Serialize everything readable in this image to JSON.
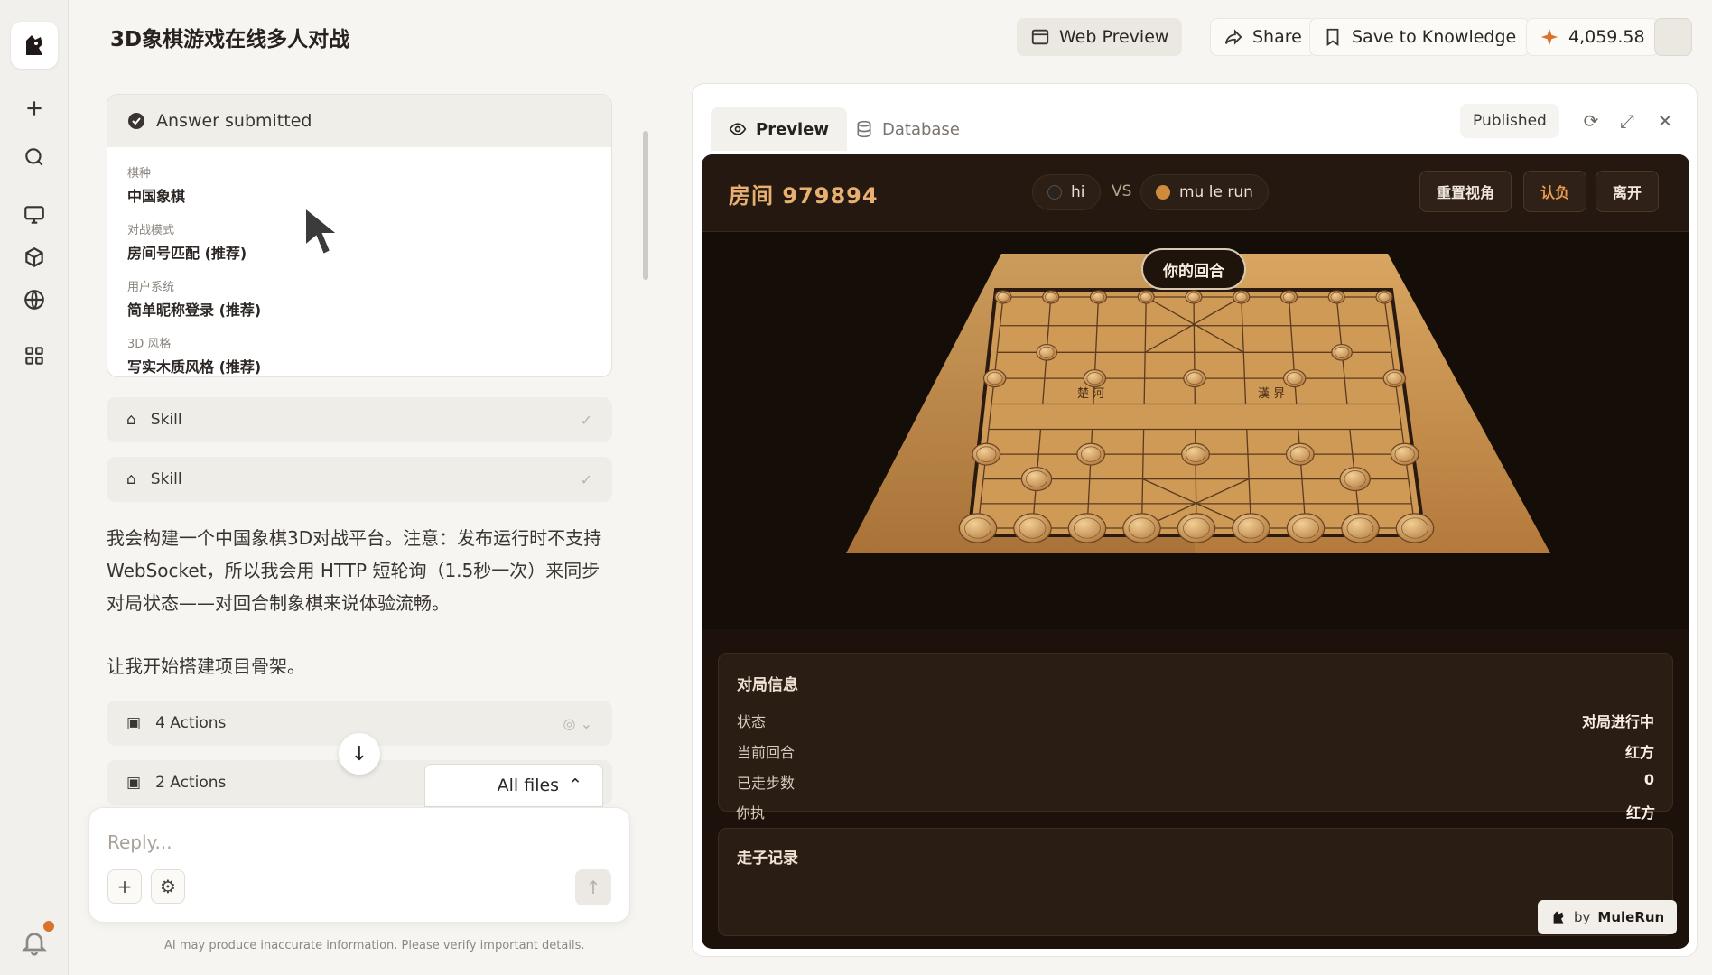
{
  "header": {
    "title": "3D象棋游戏在线多人对战",
    "web_preview": "Web Preview",
    "share": "Share",
    "save_to_knowledge": "Save to Knowledge",
    "credits": "4,059.58"
  },
  "chat": {
    "answer_card": {
      "title": "Answer submitted",
      "items": [
        {
          "q": "棋种",
          "a": "中国象棋"
        },
        {
          "q": "对战模式",
          "a": "房间号匹配 (推荐)"
        },
        {
          "q": "用户系统",
          "a": "简单昵称登录 (推荐)"
        },
        {
          "q": "3D 风格",
          "a": "写实木质风格 (推荐)"
        }
      ]
    },
    "skill1": "Skill",
    "skill2": "Skill",
    "paragraph1": "我会构建一个中国象棋3D对战平台。注意：发布运行时不支持 WebSocket，所以我会用 HTTP 短轮询（1.5秒一次）来同步对局状态——对回合制象棋来说体验流畅。",
    "paragraph2": "让我开始搭建项目骨架。",
    "actions1": "4 Actions",
    "actions2": "2 Actions",
    "all_files": "All files",
    "reply_placeholder": "Reply...",
    "disclaimer": "AI may produce inaccurate information. Please verify important details."
  },
  "preview": {
    "tab_preview": "Preview",
    "tab_database": "Database",
    "published": "Published"
  },
  "game": {
    "room": "房间 979894",
    "player1": "hi",
    "vs": "VS",
    "player2": "mu le run",
    "btn_reset_view": "重置视角",
    "btn_resign": "认负",
    "btn_leave": "离开",
    "turn_badge": "你的回合",
    "river_left": "楚 河",
    "river_right": "漢 界",
    "info": {
      "title": "对局信息",
      "status_label": "状态",
      "status_value": "对局进行中",
      "round_label": "当前回合",
      "round_value": "红方",
      "moves_label": "已走步数",
      "moves_value": "0",
      "side_label": "你执",
      "side_value": "红方"
    },
    "move_log_title": "走子记录",
    "badge_by": "by",
    "badge_brand": "MuleRun"
  },
  "colors": {
    "accent": "#e8b070",
    "resign": "#e89a4e",
    "notification": "#d9722c"
  }
}
